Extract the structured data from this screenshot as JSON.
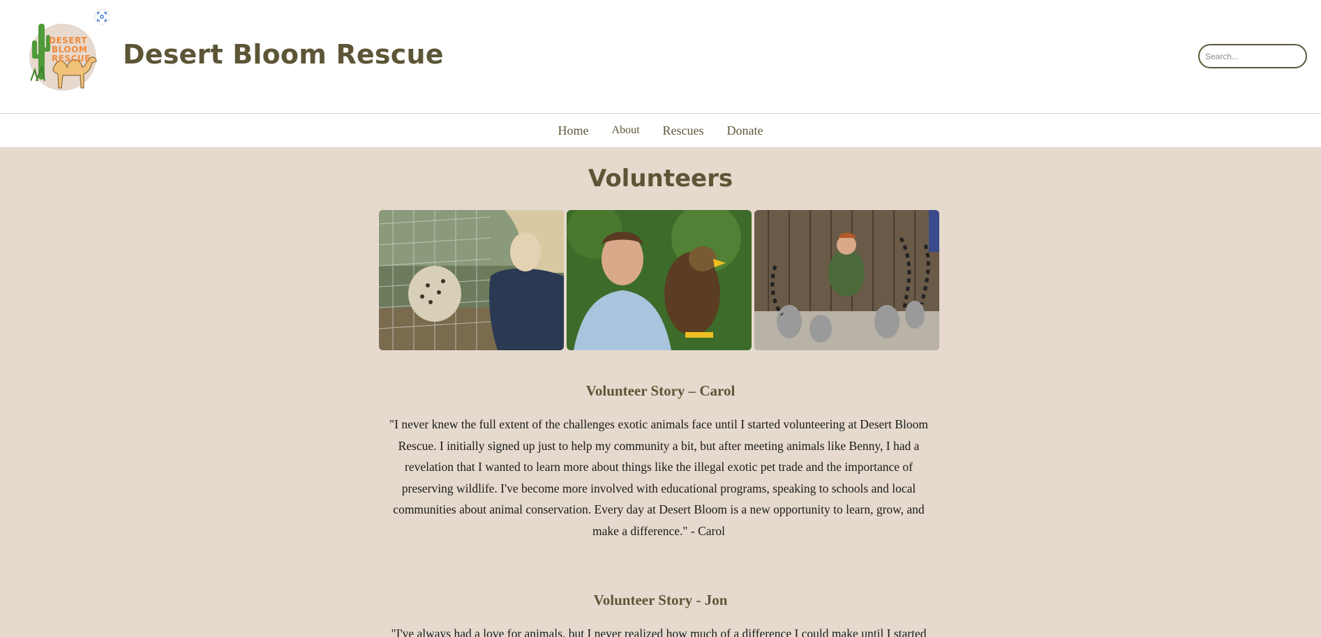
{
  "header": {
    "logo_words": [
      "DESERT",
      "BLOOM",
      "RESCUE"
    ],
    "title": "Desert Bloom Rescue",
    "search": {
      "placeholder": "Search..."
    }
  },
  "nav": {
    "items": [
      {
        "label": "Home"
      },
      {
        "label": "About"
      },
      {
        "label": "Rescues"
      },
      {
        "label": "Donate"
      }
    ]
  },
  "main": {
    "title": "Volunteers",
    "gallery": [
      {
        "icon": "volunteer-with-leopard-photo"
      },
      {
        "icon": "volunteer-with-eagle-photo"
      },
      {
        "icon": "volunteer-with-lemurs-photo"
      }
    ],
    "stories": [
      {
        "heading": "Volunteer Story – Carol",
        "text": "\"I never knew the full extent of the challenges exotic animals face until I started volunteering at Desert Bloom Rescue. I initially signed up just to help my community a bit, but after meeting animals like Benny, I had a revelation that I wanted to learn more about things like the illegal exotic pet trade and the importance of preserving wildlife. I've become more involved with educational programs, speaking to schools and local communities about animal conservation. Every day at Desert Bloom is a new opportunity to learn, grow, and make a difference.\" - Carol"
      },
      {
        "heading": "Volunteer Story - Jon",
        "text": "\"I've always had a love for animals, but I never realized how much of a difference I could make until I started"
      }
    ]
  },
  "colors": {
    "brand_olive": "#5c5637",
    "background_sand": "#e5dacd",
    "logo_orange": "#f08a3a"
  }
}
